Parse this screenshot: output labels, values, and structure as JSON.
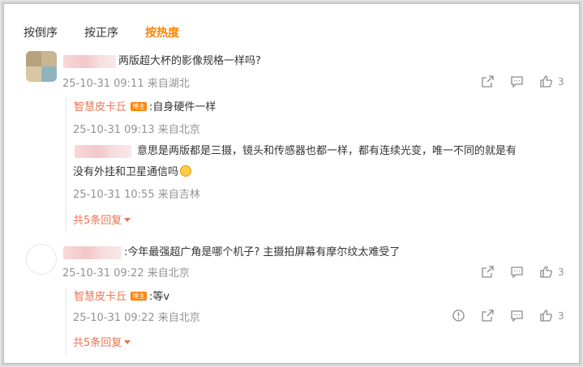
{
  "sort": {
    "reverse": "按倒序",
    "forward": "按正序",
    "hot": "按热度"
  },
  "comments": [
    {
      "text": "两版超大杯的影像规格一样吗?",
      "time": "25-10-31 09:11 来自湖北",
      "likes": "3",
      "replies": [
        {
          "name": "智慧皮卡丘",
          "badge": "博主",
          "text": ":自身硬件一样",
          "time": "25-10-31 09:13 来自北京"
        },
        {
          "text_line1": "意思是两版都是三摄，镜头和传感器也都一样，都有连续光变，唯一不同的就是有",
          "text_line2": "没有外挂和卫星通信吗",
          "time": "25-10-31 10:55 来自吉林"
        }
      ],
      "more": "共5条回复"
    },
    {
      "text": ":今年最强超广角是哪个机子? 主摄拍屏幕有摩尔纹太难受了",
      "time": "25-10-31 09:22 来自北京",
      "likes": "3",
      "replies": [
        {
          "name": "智慧皮卡丘",
          "badge": "博主",
          "text": ":等v",
          "time": "25-10-31 09:22 来自北京",
          "likes": "3"
        }
      ],
      "more": "共5条回复"
    }
  ]
}
